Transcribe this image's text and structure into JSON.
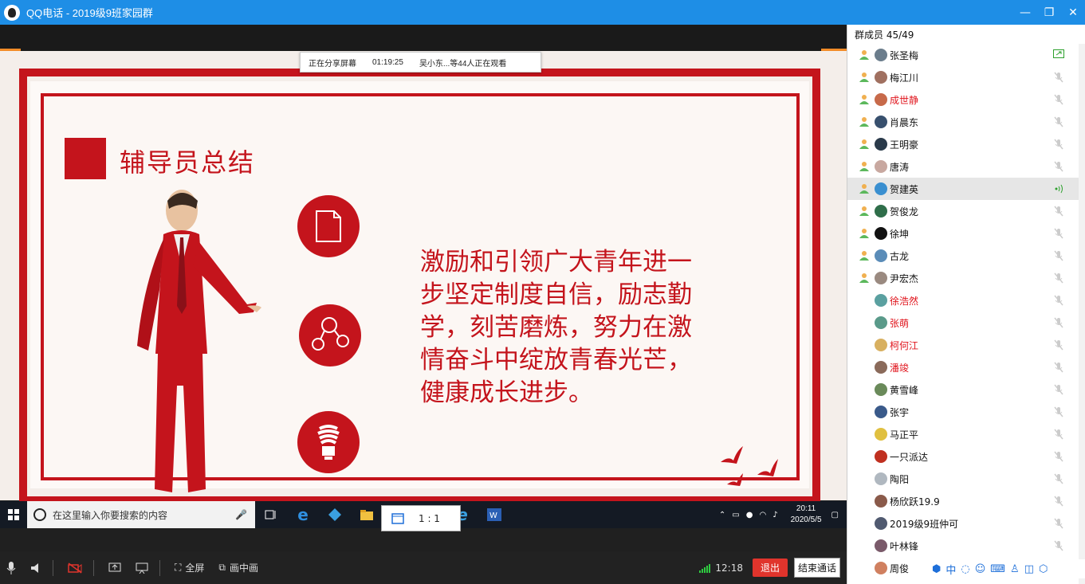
{
  "window": {
    "title": "QQ电话 - 2019级9班家园群",
    "controls": [
      "minimize-icon",
      "restore-icon",
      "close-icon"
    ]
  },
  "share_bar": {
    "status": "正在分享屏幕",
    "duration": "01:19:25",
    "viewers": "吴小东...等44人正在观看"
  },
  "slide": {
    "title": "辅导员总结",
    "body": "激励和引领广大青年进一步坚定制度自信，励志勤学，刻苦磨炼，努力在激情奋斗中绽放青春光芒，健康成长进步。",
    "colors": {
      "accent": "#c4141c",
      "background": "#f4eeea"
    }
  },
  "taskbar": {
    "search_placeholder": "在这里输入你要搜索的内容",
    "time": "20:11",
    "date": "2020/5/5"
  },
  "ratio_popup": {
    "label": "1 : 1"
  },
  "bottom_bar": {
    "fullscreen": "全屏",
    "pip": "画中画",
    "call_time": "12:18",
    "exit": "退出",
    "end_call": "结束通话"
  },
  "panel": {
    "header": "群成员 45/49",
    "members": [
      {
        "name": "张圣梅",
        "red": false,
        "online": true,
        "status": "sharing",
        "color": "#6b7d8c"
      },
      {
        "name": "梅江川",
        "red": false,
        "online": true,
        "status": "muted",
        "color": "#a07060"
      },
      {
        "name": "成世静",
        "red": true,
        "online": true,
        "status": "muted",
        "color": "#c76a4a"
      },
      {
        "name": "肖晨东",
        "red": false,
        "online": true,
        "status": "muted",
        "color": "#38506e"
      },
      {
        "name": "王明豪",
        "red": false,
        "online": true,
        "status": "muted",
        "color": "#2a3a4a"
      },
      {
        "name": "唐涛",
        "red": false,
        "online": true,
        "status": "muted",
        "color": "#c8a8a0"
      },
      {
        "name": "贺建英",
        "red": false,
        "online": true,
        "status": "speaking",
        "color": "#3a8fd0"
      },
      {
        "name": "贺俊龙",
        "red": false,
        "online": true,
        "status": "muted",
        "color": "#2f6e4a"
      },
      {
        "name": "徐坤",
        "red": false,
        "online": true,
        "status": "muted",
        "color": "#111111"
      },
      {
        "name": "古龙",
        "red": false,
        "online": true,
        "status": "muted",
        "color": "#5a8cb8"
      },
      {
        "name": "尹宏杰",
        "red": false,
        "online": true,
        "status": "muted",
        "color": "#9a8a80"
      },
      {
        "name": "徐浩然",
        "red": true,
        "online": false,
        "status": "muted",
        "color": "#5aa0a0"
      },
      {
        "name": "张萌",
        "red": true,
        "online": false,
        "status": "muted",
        "color": "#5a9a8a"
      },
      {
        "name": "柯何江",
        "red": true,
        "online": false,
        "status": "muted",
        "color": "#d8b060"
      },
      {
        "name": "潘竣",
        "red": true,
        "online": false,
        "status": "muted",
        "color": "#8a6a5a"
      },
      {
        "name": "黄雪峰",
        "red": false,
        "online": false,
        "status": "muted",
        "color": "#6a8a5a"
      },
      {
        "name": "张宇",
        "red": false,
        "online": false,
        "status": "muted",
        "color": "#3a5a8a"
      },
      {
        "name": "马正平",
        "red": false,
        "online": false,
        "status": "muted",
        "color": "#e0c040"
      },
      {
        "name": "一只派达",
        "red": false,
        "online": false,
        "status": "muted",
        "color": "#c03020"
      },
      {
        "name": "陶阳",
        "red": false,
        "online": false,
        "status": "muted",
        "color": "#b0b8c0"
      },
      {
        "name": "杨欣跃19.9",
        "red": false,
        "online": false,
        "status": "muted",
        "color": "#8a5a4a"
      },
      {
        "name": "2019级9班仲可",
        "red": false,
        "online": false,
        "status": "muted",
        "color": "#505a70"
      },
      {
        "name": "叶林锋",
        "red": false,
        "online": false,
        "status": "muted",
        "color": "#7a5a6a"
      },
      {
        "name": "周俊",
        "red": false,
        "online": false,
        "status": "muted",
        "color": "#d08060"
      }
    ]
  },
  "ime": {
    "mode": "中"
  }
}
